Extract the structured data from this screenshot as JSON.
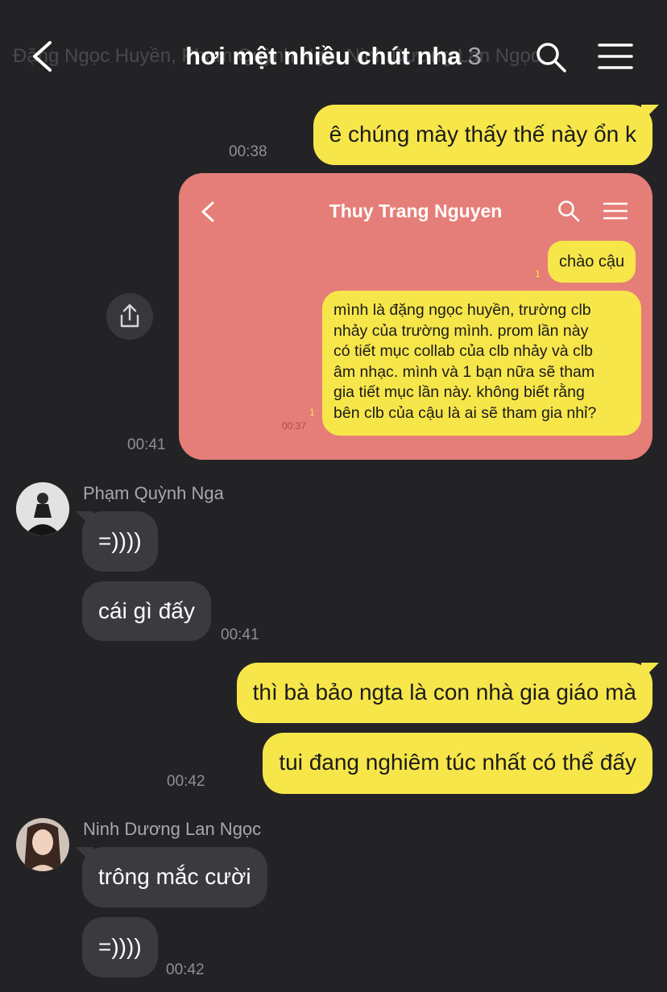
{
  "header": {
    "background_names": "Đặng Ngọc Huyền, Phạm Quỳnh Nga, Ninh Dương Lan Ngọc.",
    "title": "hơi mệt nhiều chút nha",
    "member_count": "3"
  },
  "messages": {
    "m1": {
      "text": "ê chúng mày thấy thế này ổn k",
      "time": "00:38"
    },
    "image_time": "00:41",
    "m2": {
      "sender": "Phạm Quỳnh Nga",
      "text": "=))))"
    },
    "m3": {
      "text": "cái gì đấy",
      "time": "00:41"
    },
    "m4": {
      "text": "thì bà bảo ngta là con nhà gia giáo mà"
    },
    "m5": {
      "text": "tui đang nghiêm túc nhất có thể đấy",
      "time": "00:42"
    },
    "m6": {
      "sender": "Ninh Dương Lan Ngọc",
      "text": "trông mắc cười"
    },
    "m7": {
      "text": "=))))",
      "time": "00:42"
    }
  },
  "screenshot": {
    "title": "Thuy Trang Nguyen",
    "b1": {
      "text": "chào cậu",
      "read": "1"
    },
    "b2": {
      "lines": [
        "mình là đặng ngọc huyền, trường clb",
        "nhảy của trường mình. prom lần này",
        "có tiết mục collab của clb nhảy và clb",
        "âm nhạc. mình và 1 bạn nữa sẽ tham",
        "gia tiết mục lần này. không biết rằng",
        "bên clb của cậu là ai sẽ tham gia nhỉ?"
      ],
      "read": "1",
      "time": "00:37"
    }
  },
  "colors": {
    "background": "#232326",
    "outgoing_bubble": "#f7e64a",
    "incoming_bubble": "#3b3b3f",
    "screenshot_bg": "#e57e78"
  },
  "icons": [
    "back-chevron-icon",
    "search-icon",
    "menu-icon",
    "share-icon"
  ]
}
